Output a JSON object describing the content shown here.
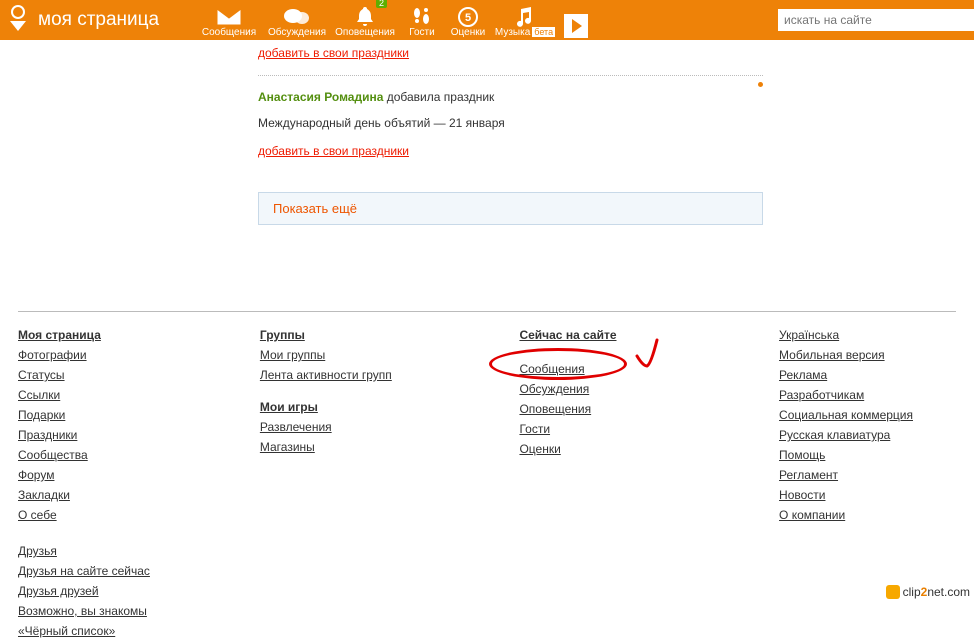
{
  "header": {
    "title": "моя страница",
    "nav": [
      {
        "label": "Сообщения"
      },
      {
        "label": "Обсуждения"
      },
      {
        "label": "Оповещения",
        "badge": "2"
      },
      {
        "label": "Гости"
      },
      {
        "label": "Оценки"
      },
      {
        "label": "Музыка",
        "beta": "бета"
      }
    ],
    "search_placeholder": "искать на сайте"
  },
  "feed": {
    "add_link_top": "добавить в свои праздники",
    "user": "Анастасия Ромадина",
    "action": "добавила праздник",
    "detail": "Международный день объятий — 21 января",
    "add_link": "добавить в свои праздники",
    "show_more": "Показать ещё"
  },
  "footer": {
    "col1": {
      "head": "Моя страница",
      "links_a": [
        "Фотографии",
        "Статусы",
        "Ссылки",
        "Подарки",
        "Праздники",
        "Сообщества",
        "Форум",
        "Закладки",
        "О себе"
      ],
      "links_b": [
        "Друзья",
        "Друзья на сайте сейчас",
        "Друзья друзей",
        "Возможно, вы знакомы",
        "«Чёрный список»"
      ]
    },
    "col2": {
      "head": "Группы",
      "links_a": [
        "Мои группы",
        "Лента активности групп"
      ],
      "sub": "Мои игры",
      "links_b": [
        "Развлечения",
        "Магазины"
      ]
    },
    "col3": {
      "head": "Сейчас на сайте",
      "links": [
        "Сообщения",
        "Обсуждения",
        "Оповещения",
        "Гости",
        "Оценки"
      ]
    },
    "col4": {
      "links": [
        "Українська",
        "Мобильная версия",
        "Реклама",
        "Разработчикам",
        "Социальная коммерция",
        "Русская клавиатура",
        "Помощь",
        "Регламент",
        "Новости",
        "О компании"
      ]
    }
  },
  "watermark": {
    "a": "clip",
    "b": "2",
    "c": "net.com"
  }
}
